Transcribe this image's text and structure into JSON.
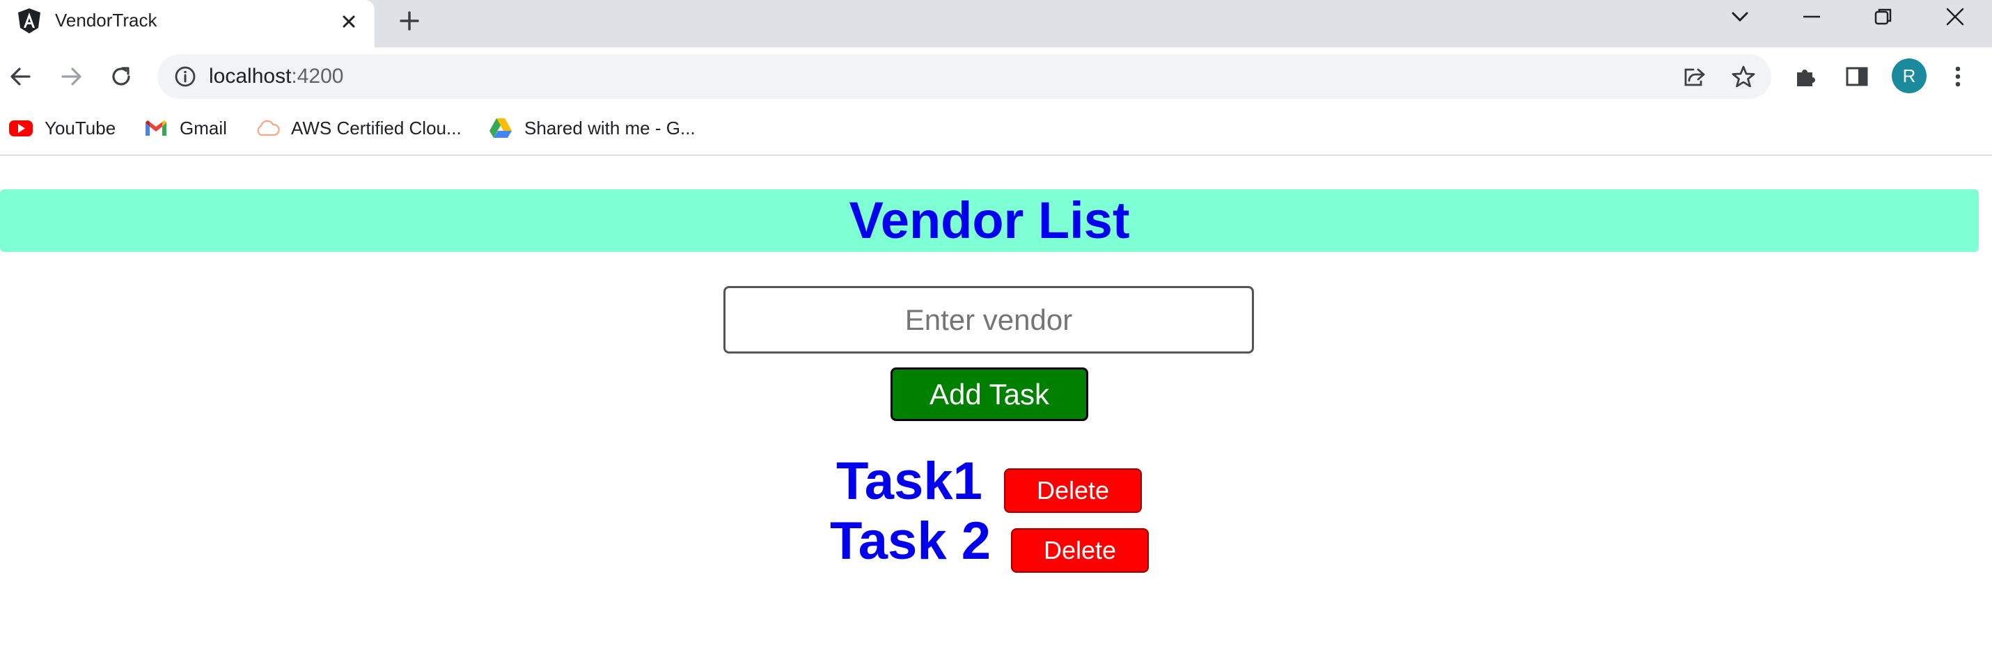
{
  "browser": {
    "tab": {
      "title": "VendorTrack",
      "favicon": "angular-icon"
    },
    "address": {
      "host": "localhost",
      "port": ":4200"
    },
    "profile_initial": "R",
    "bookmarks": [
      {
        "label": "YouTube",
        "icon": "youtube-icon"
      },
      {
        "label": "Gmail",
        "icon": "gmail-icon"
      },
      {
        "label": "AWS Certified Clou...",
        "icon": "cloud-icon"
      },
      {
        "label": "Shared with me - G...",
        "icon": "google-drive-icon"
      }
    ]
  },
  "page": {
    "title": "Vendor List",
    "input": {
      "placeholder": "Enter vendor",
      "value": ""
    },
    "add_button_label": "Add Task",
    "tasks": [
      {
        "name": "Task1",
        "delete_label": "Delete"
      },
      {
        "name": "Task 2",
        "delete_label": "Delete"
      }
    ]
  },
  "colors": {
    "banner": "#7fffd4",
    "title_text": "#0000ee",
    "add_button": "#008000",
    "delete_button": "#ff0000"
  }
}
